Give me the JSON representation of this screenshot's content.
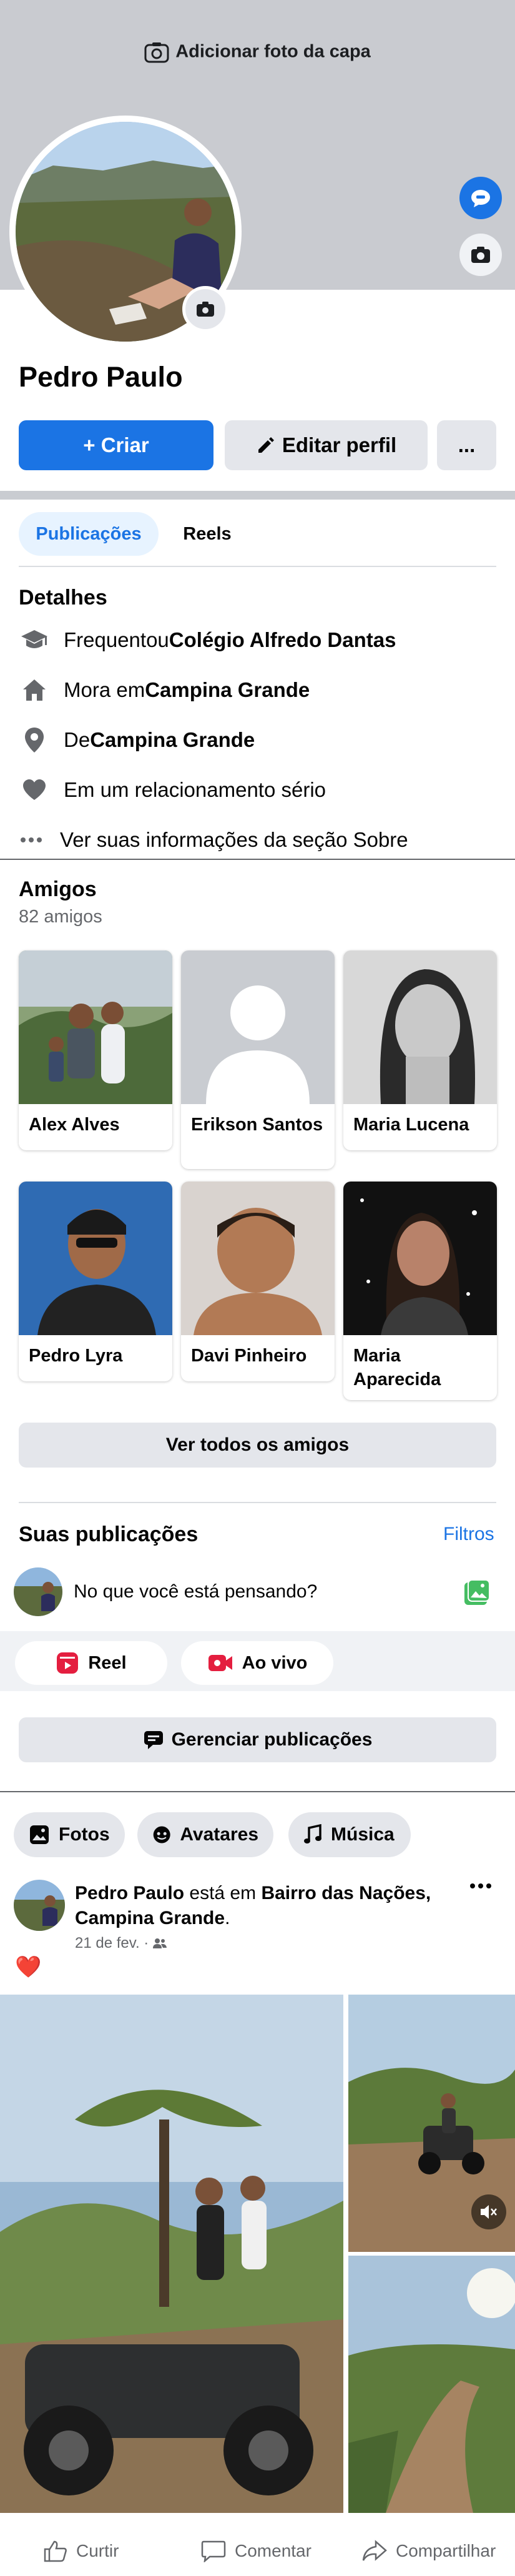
{
  "cover": {
    "add_cover_label": "Adicionar foto da capa"
  },
  "profile": {
    "name": "Pedro Paulo"
  },
  "actions": {
    "create_label": "+ Criar",
    "edit_label": "Editar perfil",
    "more_label": "..."
  },
  "tabs": [
    {
      "label": "Publicações",
      "active": true
    },
    {
      "label": "Reels",
      "active": false
    }
  ],
  "details": {
    "title": "Detalhes",
    "items": [
      {
        "prefix": "Frequentou ",
        "bold": "Colégio Alfredo Dantas",
        "icon": "graduation-cap-icon"
      },
      {
        "prefix": "Mora em ",
        "bold": "Campina Grande",
        "icon": "home-icon"
      },
      {
        "prefix": "De ",
        "bold": "Campina Grande",
        "icon": "location-pin-icon"
      },
      {
        "prefix": "Em um relacionamento sério",
        "bold": "",
        "icon": "heart-icon"
      }
    ],
    "see_about": "Ver suas informações da seção Sobre"
  },
  "friends": {
    "title": "Amigos",
    "count": "82 amigos",
    "list": [
      {
        "name": "Alex Alves"
      },
      {
        "name": "Erikson Santos"
      },
      {
        "name": "Maria Lucena"
      },
      {
        "name": "Pedro Lyra"
      },
      {
        "name": "Davi Pinheiro"
      },
      {
        "name": "Maria Aparecida"
      }
    ],
    "see_all": "Ver todos os amigos"
  },
  "posts": {
    "title": "Suas publicações",
    "filters": "Filtros",
    "composer_placeholder": "No que você está pensando?",
    "reel_label": "Reel",
    "live_label": "Ao vivo",
    "manage_label": "Gerenciar publicações"
  },
  "media_chips": [
    {
      "label": "Fotos"
    },
    {
      "label": "Avatares"
    },
    {
      "label": "Música"
    }
  ],
  "post": {
    "author": "Pedro Paulo",
    "mid": " está em ",
    "place": "Bairro das Nações, Campina Grande",
    "end": ".",
    "date": "21 de fev. ·",
    "reaction": "❤️"
  },
  "post_actions": {
    "like": "Curtir",
    "comment": "Comentar",
    "share": "Compartilhar"
  },
  "colors": {
    "primary": "#1b74e4",
    "tab_active_bg": "#e7f3ff",
    "cover_bg": "#c9cbd0"
  }
}
